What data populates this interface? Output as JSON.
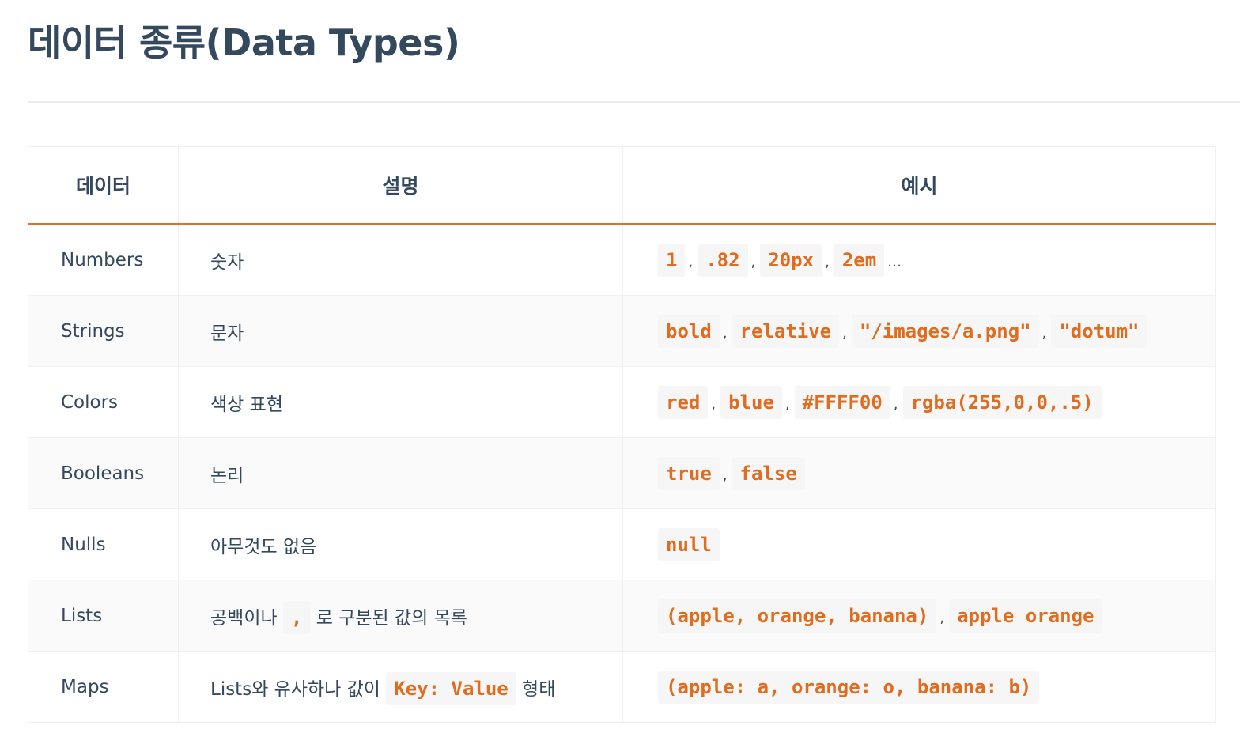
{
  "title": "데이터 종류(Data Types)",
  "table": {
    "headers": [
      "데이터",
      "설명",
      "예시"
    ],
    "rows": [
      {
        "type": "Numbers",
        "desc": [
          {
            "t": "숫자"
          }
        ],
        "examples": [
          "1",
          ".82",
          "20px",
          "2em"
        ],
        "suffix": "…"
      },
      {
        "type": "Strings",
        "desc": [
          {
            "t": "문자"
          }
        ],
        "examples": [
          "bold",
          "relative",
          "\"/images/a.png\"",
          "\"dotum\""
        ]
      },
      {
        "type": "Colors",
        "desc": [
          {
            "t": "색상 표현"
          }
        ],
        "examples": [
          "red",
          "blue",
          "#FFFF00",
          "rgba(255,0,0,.5)"
        ]
      },
      {
        "type": "Booleans",
        "desc": [
          {
            "t": "논리"
          }
        ],
        "examples": [
          "true",
          "false"
        ]
      },
      {
        "type": "Nulls",
        "desc": [
          {
            "t": "아무것도 없음"
          }
        ],
        "examples": [
          "null"
        ]
      },
      {
        "type": "Lists",
        "desc": [
          {
            "t": "공백이나 "
          },
          {
            "c": ","
          },
          {
            "t": " 로 구분된 값의 목록"
          }
        ],
        "examples": [
          "(apple, orange, banana)",
          "apple orange"
        ]
      },
      {
        "type": "Maps",
        "desc": [
          {
            "t": "Lists와 유사하나 값이 "
          },
          {
            "c": "Key: Value"
          },
          {
            "t": " 형태"
          }
        ],
        "examples": [
          "(apple: a, orange: o, banana: b)"
        ]
      }
    ],
    "separator": ","
  },
  "colors": {
    "text": "#34495e",
    "accent": "#e06c1f",
    "code_bg": "#f6f6f6"
  }
}
